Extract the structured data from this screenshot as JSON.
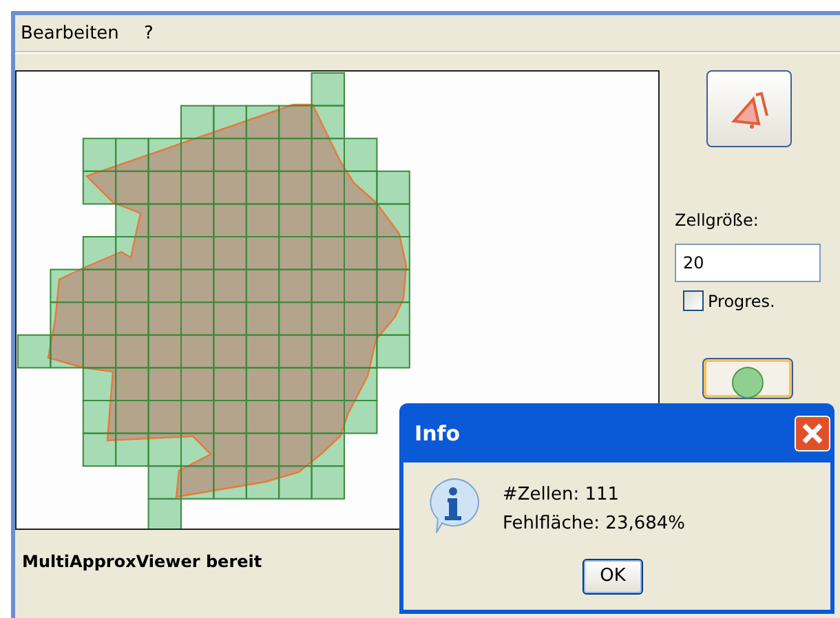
{
  "menu": [
    {
      "label": "Bearbeiten"
    },
    {
      "label": "?"
    }
  ],
  "side_panel": {
    "cell_size_label": "Zellgröße:",
    "cell_size": "20",
    "progressive": {
      "label": "Progres.",
      "checked": false
    }
  },
  "status_bar": "MultiApproxViewer bereit",
  "dialog": {
    "title": "Info",
    "lines": [
      "#Zellen: 111",
      "Fehlfläche: 23,684%"
    ],
    "button": "OK"
  }
}
